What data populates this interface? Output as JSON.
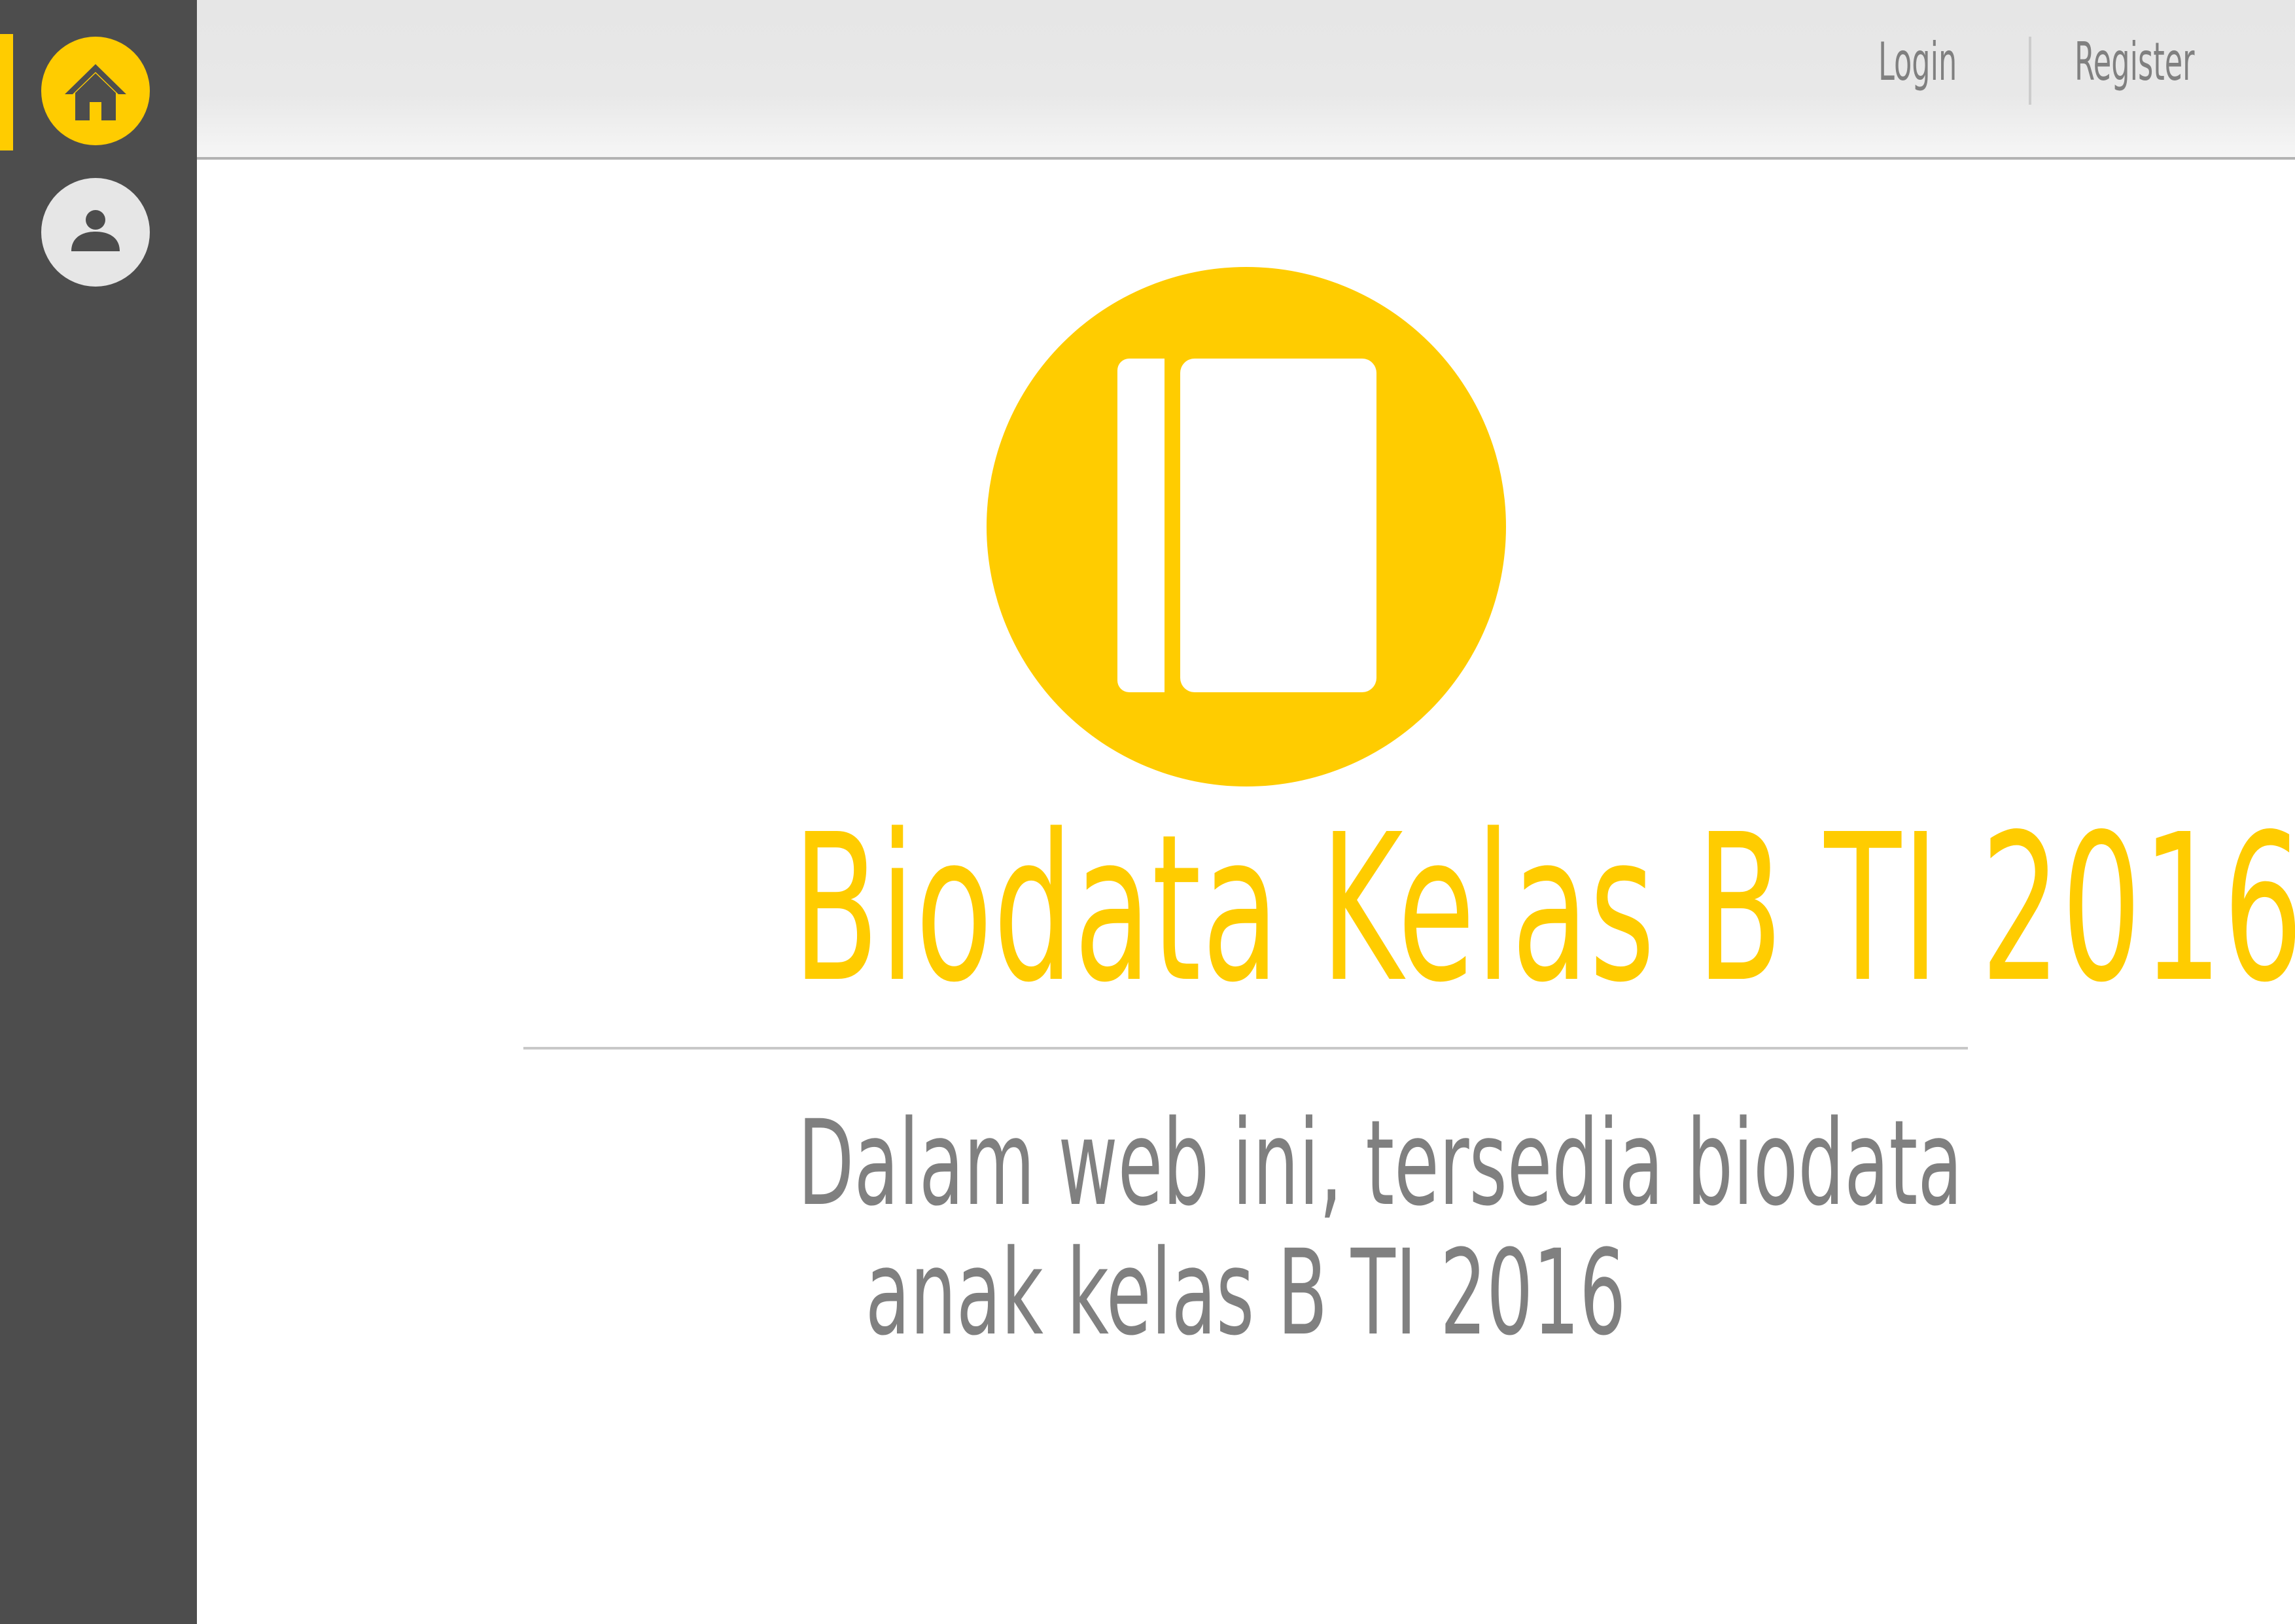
{
  "header": {
    "login_label": "Login",
    "register_label": "Register"
  },
  "sidebar": {
    "items": [
      {
        "name": "home",
        "icon": "home-icon",
        "active": true
      },
      {
        "name": "user",
        "icon": "user-icon",
        "active": false
      }
    ]
  },
  "main": {
    "logo_icon": "book-icon",
    "title": "Biodata Kelas B TI 2016",
    "subtitle_lines": [
      "Dalam web ini, tersedia biodata",
      "anak kelas B TI 2016"
    ]
  },
  "colors": {
    "accent": "#ffcc00",
    "sidebar": "#4d4d4d",
    "header_bg": "#e6e6e6",
    "text_gray": "#808080"
  }
}
